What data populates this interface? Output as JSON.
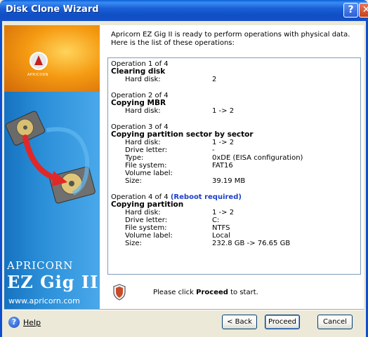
{
  "window": {
    "title": "Disk Clone Wizard",
    "help_glyph": "?",
    "close_glyph": "✕"
  },
  "sidebar": {
    "logo_text": "APRICORN",
    "brand_name": "Apricorn",
    "product_name": "EZ Gig II",
    "url": "www.apricorn.com"
  },
  "intro_text": "Apricorn EZ Gig II is ready to perform operations with physical data. Here is the list of these operations:",
  "operations": [
    {
      "header": "Operation 1 of 4",
      "title": "Clearing disk",
      "rows": [
        {
          "k": "Hard disk:",
          "v": "2"
        }
      ]
    },
    {
      "header": "Operation 2 of 4",
      "title": "Copying MBR",
      "rows": [
        {
          "k": "Hard disk:",
          "v": "1 -> 2"
        }
      ]
    },
    {
      "header": "Operation 3 of 4",
      "title": "Copying partition sector by sector",
      "rows": [
        {
          "k": "Hard disk:",
          "v": "1 -> 2"
        },
        {
          "k": "Drive letter:",
          "v": "-"
        },
        {
          "k": "Type:",
          "v": "0xDE (EISA configuration)"
        },
        {
          "k": "File system:",
          "v": "FAT16"
        },
        {
          "k": "Volume label:",
          "v": ""
        },
        {
          "k": "Size:",
          "v": "39.19 MB"
        }
      ]
    },
    {
      "header": "Operation 4 of 4",
      "reboot": "(Reboot required)",
      "title": "Copying partition",
      "rows": [
        {
          "k": "Hard disk:",
          "v": "1 -> 2"
        },
        {
          "k": "Drive letter:",
          "v": "C:"
        },
        {
          "k": "File system:",
          "v": "NTFS"
        },
        {
          "k": "Volume label:",
          "v": "Local"
        },
        {
          "k": "Size:",
          "v": "232.8 GB -> 76.65 GB"
        }
      ]
    }
  ],
  "hint": {
    "prefix": "Please click ",
    "bold": "Proceed",
    "suffix": " to start."
  },
  "footer": {
    "help_icon": "?",
    "help_label": "Help",
    "back_label": "< Back",
    "proceed_label": "Proceed",
    "cancel_label": "Cancel"
  }
}
